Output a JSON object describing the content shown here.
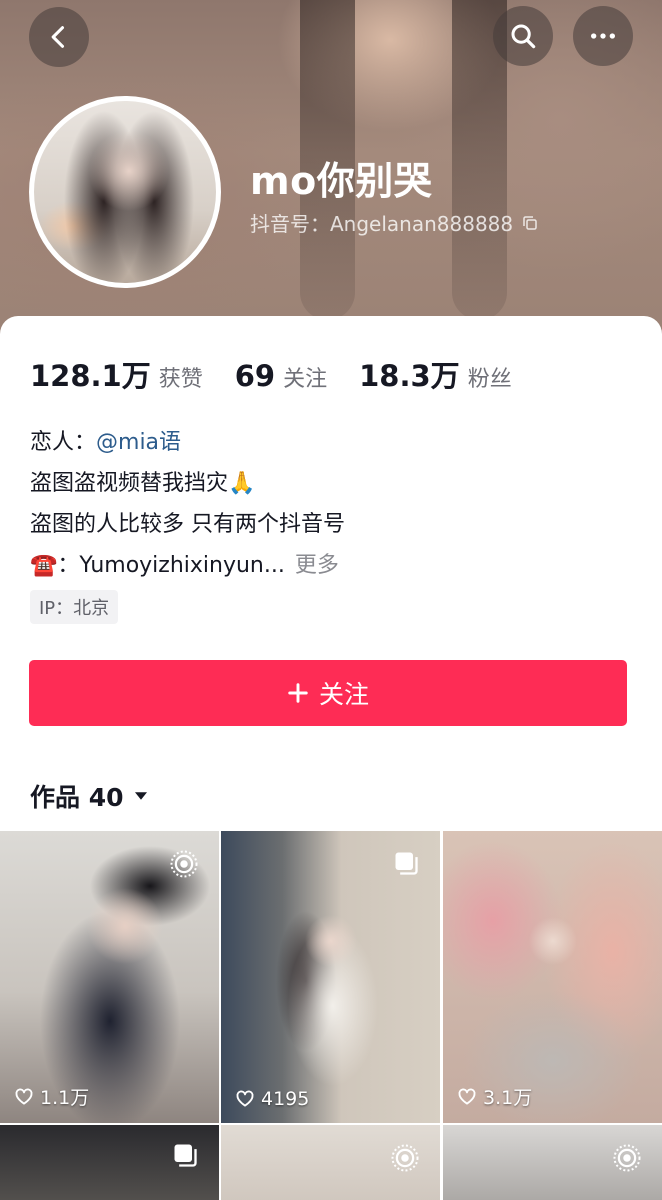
{
  "header": {
    "nickname": "mo你别哭",
    "douyin_id": "抖音号：Angelanan888888",
    "icons": {
      "back": "chevron-left-icon",
      "search": "search-icon",
      "more": "more-horizontal-icon",
      "copy": "copy-icon"
    }
  },
  "stats": [
    {
      "value": "128.1万",
      "label": "获赞"
    },
    {
      "value": "69",
      "label": "关注"
    },
    {
      "value": "18.3万",
      "label": "粉丝"
    }
  ],
  "bio": {
    "line1_prefix": "恋人：",
    "line1_mention": "@mia语",
    "line2": "盗图盗视频替我挡灾🙏",
    "line3": "盗图的人比较多 只有两个抖音号",
    "line4_prefix": "☎️：",
    "line4_text": "Yumoyizhixinyun...",
    "more_label": "更多",
    "ip": "IP：北京"
  },
  "follow_button": {
    "label": "关注",
    "icon": "plus-icon"
  },
  "works_tab": {
    "label": "作品 40",
    "icon": "caret-down-icon"
  },
  "videos": [
    {
      "likes": "1.1万",
      "badge": "live-photo-icon"
    },
    {
      "likes": "4195",
      "badge": "gallery-icon"
    },
    {
      "likes": "3.1万",
      "badge": ""
    },
    {
      "likes": "",
      "badge": "gallery-icon"
    },
    {
      "likes": "",
      "badge": "live-photo-icon"
    },
    {
      "likes": "",
      "badge": "live-photo-icon"
    }
  ],
  "colors": {
    "accent": "#fe2c55",
    "mention": "#2d5c8c",
    "text": "#161823",
    "muted": "#6f7078"
  }
}
